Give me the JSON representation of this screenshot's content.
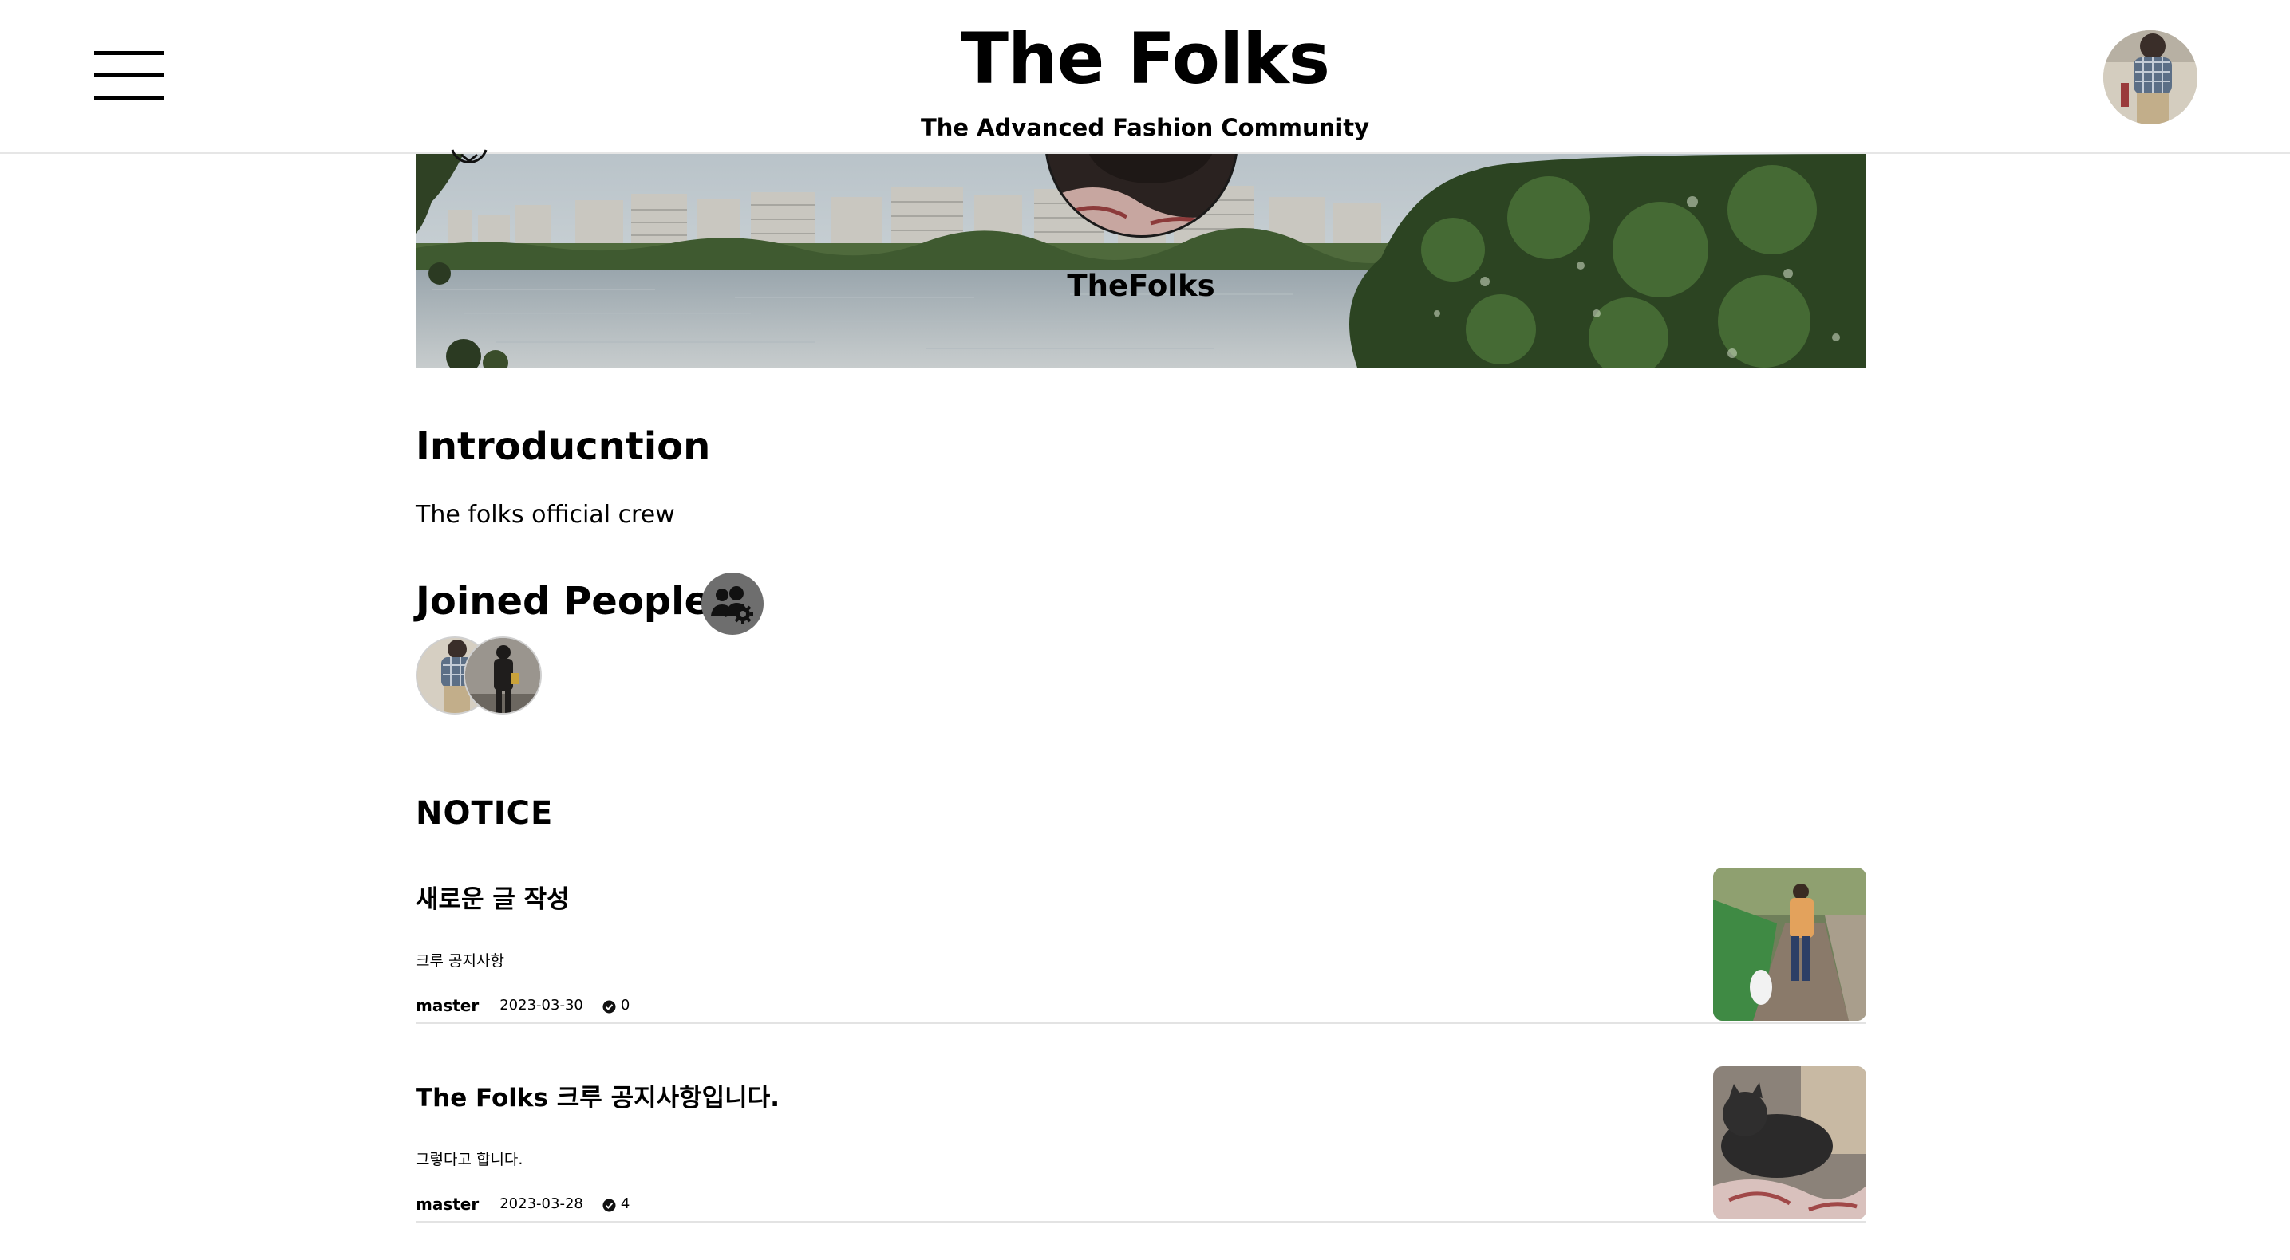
{
  "header": {
    "title": "The Folks",
    "subtitle": "The Advanced Fashion Community",
    "menu_icon": "hamburger-menu-icon",
    "profile_icon": "user-avatar"
  },
  "crew": {
    "name": "TheFolks",
    "banner_icon": "chevron-circle-icon"
  },
  "introduction": {
    "heading": "Introducntion",
    "text": "The folks official crew"
  },
  "joined": {
    "heading": "Joined People",
    "settings_icon": "users-cog-icon"
  },
  "notice": {
    "heading": "NOTICE",
    "posts": [
      {
        "title": "새로운 글 작성",
        "subtitle": "크루 공지사항",
        "author": "master",
        "date": "2023-03-30",
        "count": "0"
      },
      {
        "title": "The Folks 크루 공지사항입니다.",
        "subtitle": "그렇다고 합니다.",
        "author": "master",
        "date": "2023-03-28",
        "count": "4"
      }
    ]
  }
}
